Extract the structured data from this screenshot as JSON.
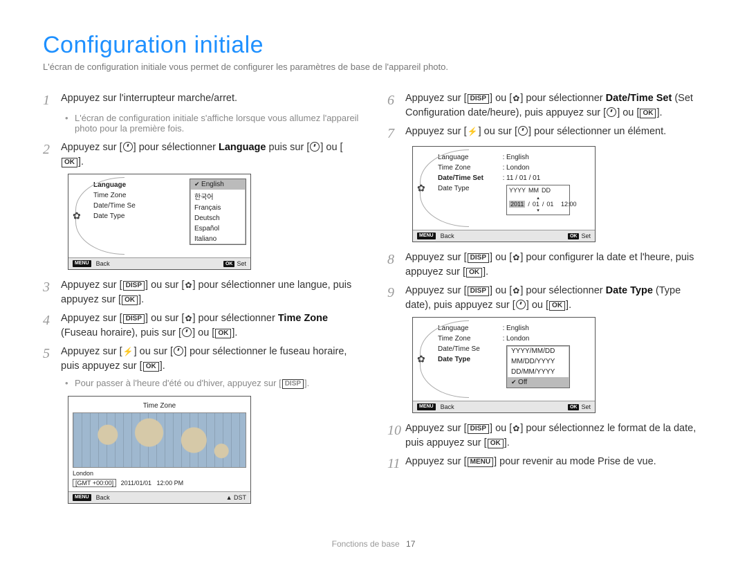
{
  "title": "Configuration initiale",
  "intro": "L'écran de configuration initiale vous permet de configurer les paramètres de base de l'appareil photo.",
  "buttons": {
    "disp": "DISP",
    "ok": "OK",
    "menu": "MENU"
  },
  "words": {
    "ou": "ou",
    "ou_sur": "ou sur"
  },
  "steps": {
    "s1": "Appuyez sur l'interrupteur marche/arret.",
    "s1_bullet": "L'écran de configuration initiale s'affiche lorsque vous allumez l'appareil photo pour la première fois.",
    "s2_a": "Appuyez sur [",
    "s2_b": "] pour sélectionner ",
    "s2_lang": "Language",
    "s2_c": " puis sur [",
    "s2_d": "] ou [",
    "s2_e": "].",
    "s3_a": "Appuyez sur [",
    "s3_b": "] ou sur [",
    "s3_c": "] pour sélectionner une langue, puis appuyez sur [",
    "s3_d": "].",
    "s4_a": "Appuyez sur [",
    "s4_b": "] ou sur [",
    "s4_c": "] pour sélectionner ",
    "s4_tz": "Time Zone",
    "s4_d": " (Fuseau horaire), puis sur [",
    "s4_e": "] ou [",
    "s4_f": "].",
    "s5_a": "Appuyez sur [",
    "s5_b": "] ou sur [",
    "s5_c": "] pour sélectionner le fuseau horaire, puis appuyez sur [",
    "s5_d": "].",
    "s5_bullet_a": "Pour passer à l'heure d'été ou d'hiver, appuyez sur [",
    "s5_bullet_b": "].",
    "s6_a": "Appuyez sur [",
    "s6_b": "] ou [",
    "s6_c": "] pour sélectionner ",
    "s6_dts": "Date/Time Set",
    "s6_d": " (Set Configuration date/heure), puis appuyez sur [",
    "s6_e": "] ou [",
    "s6_f": "].",
    "s7_a": "Appuyez sur [",
    "s7_b": "] ou sur [",
    "s7_c": "] pour sélectionner un élément.",
    "s8_a": "Appuyez sur [",
    "s8_b": "] ou [",
    "s8_c": "] pour configurer la date et l'heure, puis appuyez sur [",
    "s8_d": "].",
    "s9_a": "Appuyez sur [",
    "s9_b": "] ou [",
    "s9_c": "] pour sélectionner ",
    "s9_dt": "Date Type",
    "s9_d": " (Type date), puis appuyez sur [",
    "s9_e": "] ou [",
    "s9_f": "].",
    "s10_a": "Appuyez sur [",
    "s10_b": "] ou [",
    "s10_c": "] pour sélectionnez le format de la date, puis appuyez sur [",
    "s10_d": "].",
    "s11_a": "Appuyez sur [",
    "s11_b": "] pour revenir au mode Prise de vue."
  },
  "screen_labels": {
    "language": "Language",
    "timezone": "Time Zone",
    "datetimeset": "Date/Time Set",
    "datetype": "Date Type",
    "datetimeset_short": "Date/Time Se",
    "back": "Back",
    "set": "Set",
    "dst": "DST"
  },
  "lang_options": [
    "English",
    "한국어",
    "Français",
    "Deutsch",
    "Español",
    "Italiano"
  ],
  "tz_screen": {
    "title": "Time Zone",
    "city": "London",
    "gmt": "[GMT +00:00]",
    "date": "2011/01/01",
    "time": "12:00 PM"
  },
  "summary_values": {
    "language": "English",
    "timezone": "London",
    "datetimeset": "11 / 01 / 01"
  },
  "ymd": {
    "h1": "YYYY",
    "h2": "MM",
    "h3": "DD",
    "yy": "2011",
    "sep": "/",
    "mm": "01",
    "dd": "01",
    "time": "12:00"
  },
  "datetype_options": [
    "YYYY/MM/DD",
    "MM/DD/YYYY",
    "DD/MM/YYYY",
    "Off"
  ],
  "footer": {
    "section": "Fonctions de base",
    "page": "17"
  }
}
